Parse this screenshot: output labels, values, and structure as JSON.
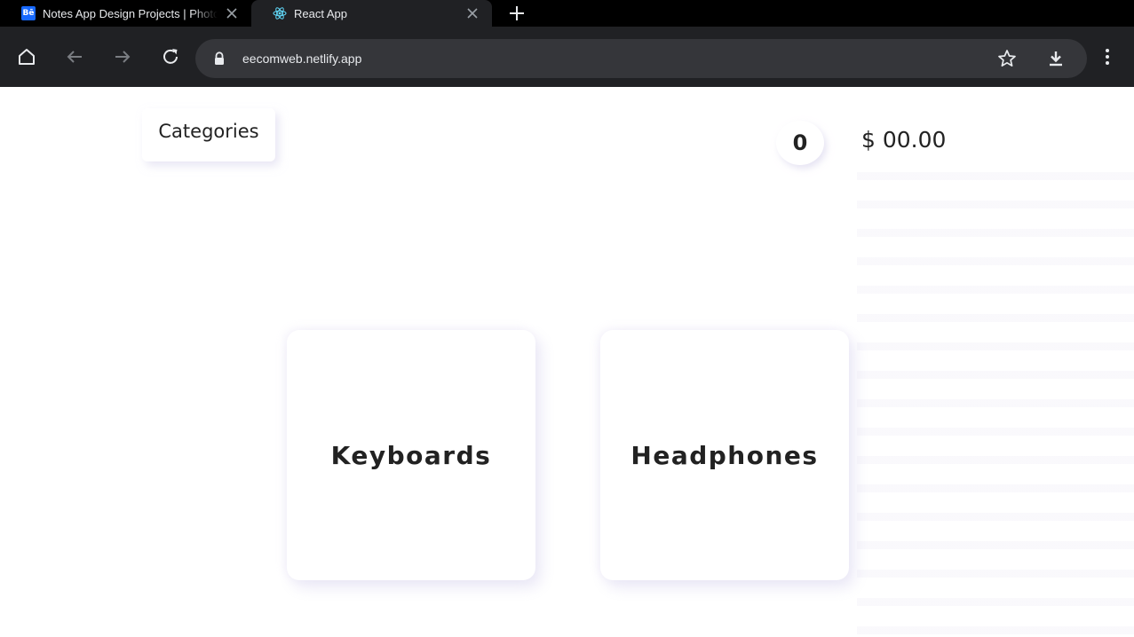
{
  "browser": {
    "tabs": [
      {
        "title": "Notes App Design Projects | Photos",
        "favicon": "behance-icon",
        "active": false
      },
      {
        "title": "React App",
        "favicon": "react-icon",
        "active": true
      }
    ],
    "url": "eecomweb.netlify.app",
    "icons": {
      "home": "home-icon",
      "back": "back-arrow-icon",
      "forward": "forward-arrow-icon",
      "reload": "reload-icon",
      "lock": "lock-icon",
      "bookmark": "star-icon",
      "download": "download-icon",
      "menu": "kebab-menu-icon",
      "new_tab": "plus-icon",
      "close": "close-icon"
    },
    "colors": {
      "tabstrip": "#000000",
      "toolbar": "#202124",
      "omnibox": "#35363a"
    }
  },
  "page": {
    "categories_label": "Categories",
    "cart": {
      "count": "0",
      "total": "$ 00.00"
    },
    "category_cards": [
      "Keyboards",
      "Headphones"
    ]
  }
}
